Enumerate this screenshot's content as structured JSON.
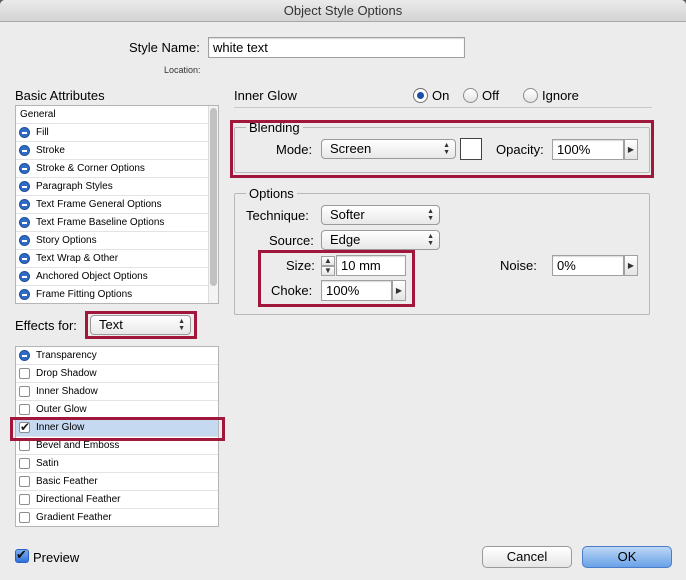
{
  "window": {
    "title": "Object Style Options"
  },
  "style_name": {
    "label": "Style Name:",
    "value": "white text"
  },
  "location": {
    "label": "Location:"
  },
  "basic_attributes": {
    "heading": "Basic Attributes",
    "items": [
      "General",
      "Fill",
      "Stroke",
      "Stroke & Corner Options",
      "Paragraph Styles",
      "Text Frame General Options",
      "Text Frame Baseline Options",
      "Story Options",
      "Text Wrap & Other",
      "Anchored Object Options",
      "Frame Fitting Options"
    ]
  },
  "effects_for": {
    "label": "Effects for:",
    "value": "Text"
  },
  "effects": {
    "items": [
      {
        "label": "Transparency",
        "state": "icon"
      },
      {
        "label": "Drop Shadow",
        "state": "unchecked"
      },
      {
        "label": "Inner Shadow",
        "state": "unchecked"
      },
      {
        "label": "Outer Glow",
        "state": "unchecked"
      },
      {
        "label": "Inner Glow",
        "state": "checked",
        "selected": true
      },
      {
        "label": "Bevel and Emboss",
        "state": "unchecked"
      },
      {
        "label": "Satin",
        "state": "unchecked"
      },
      {
        "label": "Basic Feather",
        "state": "unchecked"
      },
      {
        "label": "Directional Feather",
        "state": "unchecked"
      },
      {
        "label": "Gradient Feather",
        "state": "unchecked"
      }
    ]
  },
  "panel": {
    "title": "Inner Glow",
    "radio_on": "On",
    "radio_off": "Off",
    "radio_ignore": "Ignore",
    "selected_radio": "On"
  },
  "blending": {
    "title": "Blending",
    "mode_label": "Mode:",
    "mode_value": "Screen",
    "swatch_color": "#ffffff",
    "opacity_label": "Opacity:",
    "opacity_value": "100%"
  },
  "options": {
    "title": "Options",
    "technique_label": "Technique:",
    "technique_value": "Softer",
    "source_label": "Source:",
    "source_value": "Edge",
    "size_label": "Size:",
    "size_value": "10 mm",
    "choke_label": "Choke:",
    "choke_value": "100%",
    "noise_label": "Noise:",
    "noise_value": "0%"
  },
  "footer": {
    "preview_label": "Preview",
    "cancel_label": "Cancel",
    "ok_label": "OK"
  },
  "colors": {
    "highlight": "#a0173b",
    "selection": "#c5d9f1",
    "accent": "#2f6bc7"
  }
}
